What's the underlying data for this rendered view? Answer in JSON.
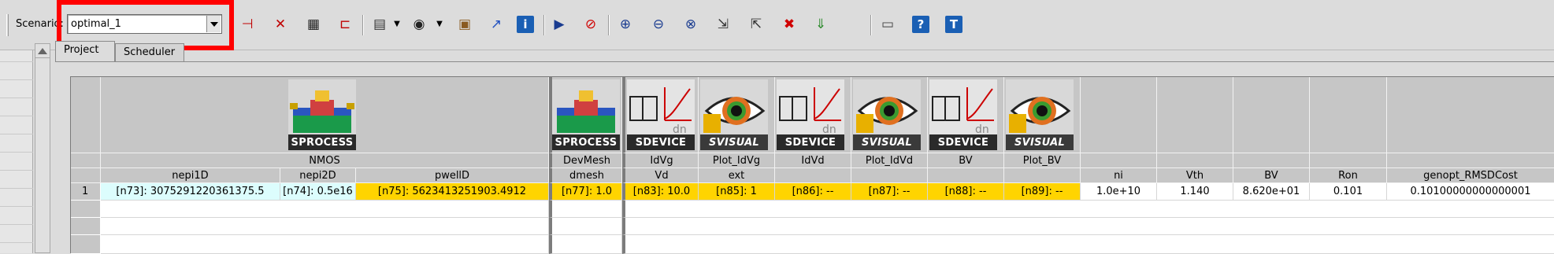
{
  "toolbar": {
    "scenario_label": "Scenario:",
    "scenario_value": "optimal_1",
    "icons": [
      "split-icon",
      "merge-icon",
      "table-icon",
      "tree-icon",
      "doc-icon",
      "dropdown-arrow-icon",
      "eye-icon",
      "dropdown-arrow-icon",
      "tools-icon",
      "chart-icon",
      "info-icon",
      "run-icon",
      "stop-icon",
      "zoom-in-icon",
      "zoom-out-icon",
      "zoom-fit-icon",
      "export-icon",
      "import-icon",
      "cross-icon",
      "download-icon",
      "console-icon",
      "help-icon",
      "terminal-icon"
    ]
  },
  "tabs": [
    "Project",
    "Scheduler"
  ],
  "tools": [
    {
      "tool": "SPROCESS",
      "step": "NMOS"
    },
    {
      "tool": "SPROCESS",
      "step": "DevMesh"
    },
    {
      "tool": "SDEVICE",
      "step": "IdVg"
    },
    {
      "tool": "SVISUAL",
      "step": "Plot_IdVg"
    },
    {
      "tool": "SDEVICE",
      "step": "IdVd"
    },
    {
      "tool": "SVISUAL",
      "step": "Plot_IdVd"
    },
    {
      "tool": "SDEVICE",
      "step": "BV"
    },
    {
      "tool": "SVISUAL",
      "step": "Plot_BV"
    }
  ],
  "parameters": [
    "nepi1D",
    "nepi2D",
    "pwellD",
    "dmesh",
    "Vd",
    "ext",
    "",
    "",
    "",
    ""
  ],
  "variables": [
    "ni",
    "Vth",
    "BV",
    "Ron",
    "genopt_RMSDCost"
  ],
  "rows": [
    {
      "index": "1",
      "params": [
        "[n73]: 3075291220361375.5",
        "[n74]: 0.5e16",
        "[n75]: 5623413251903.4912",
        "[n77]: 1.0",
        "[n83]: 10.0",
        "[n85]: 1",
        "[n86]: --",
        "[n87]: --",
        "[n88]: --",
        "[n89]: --"
      ],
      "vars": [
        "1.0e+10",
        "1.140",
        "8.620e+01",
        "0.101",
        "0.10100000000000001"
      ]
    }
  ],
  "colors": {
    "selected_param": "#dcfdfd",
    "node_highlight": "#ffd400",
    "annotation_box": "#ff0000"
  }
}
